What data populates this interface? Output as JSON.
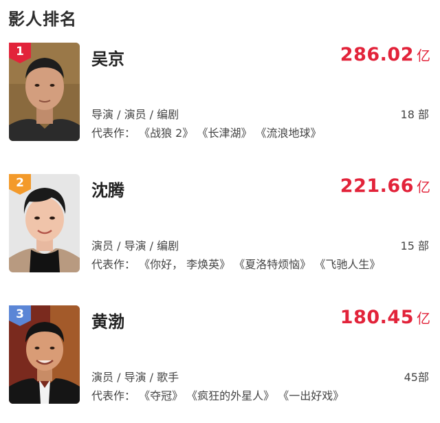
{
  "header": {
    "title": "影人排名"
  },
  "entries": [
    {
      "rank": "1",
      "badge_color": "#e2233a",
      "name": "吴京",
      "boxoffice": "286.02",
      "unit": "亿",
      "roles": "导演 / 演员 / 编剧",
      "film_count": "18 部",
      "works": "代表作： 《战狼 2》 《长津湖》 《流浪地球》"
    },
    {
      "rank": "2",
      "badge_color": "#f39a2b",
      "name": "沈腾",
      "boxoffice": "221.66",
      "unit": "亿",
      "roles": "演员 / 导演 / 编剧",
      "film_count": "15 部",
      "works": "代表作： 《你好， 李焕英》 《夏洛特烦恼》 《飞驰人生》"
    },
    {
      "rank": "3",
      "badge_color": "#5b86d6",
      "name": "黄渤",
      "boxoffice": "180.45",
      "unit": "亿",
      "roles": "演员 / 导演 / 歌手",
      "film_count": "45部",
      "works": "代表作： 《夺冠》 《疯狂的外星人》 《一出好戏》"
    }
  ],
  "colors": {
    "accent": "#e2233a",
    "text": "#222222",
    "muted": "#444444"
  },
  "icons": [
    "actor-photo",
    "rank-badge-icon"
  ]
}
